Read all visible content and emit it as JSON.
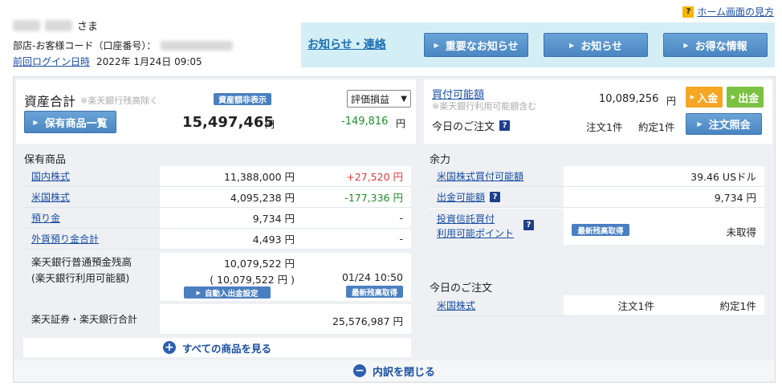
{
  "header": {
    "help_link": "ホーム画面の見方",
    "help_icon": "?",
    "user_suffix": "さま",
    "branch_label": "部店-お客様コード（口座番号）：",
    "last_login_label": "前回ログイン日時",
    "last_login_value": "2022年 1月24日 09:05"
  },
  "notice": {
    "title": "お知らせ・連絡",
    "buttons": [
      "重要なお知らせ",
      "お知らせ",
      "お得な情報"
    ]
  },
  "assets": {
    "label": "資産合計",
    "note": "※楽天銀行残高除く",
    "hide_button": "資産額非表示",
    "holdings_button": "保有商品一覧",
    "total": "15,497,465",
    "yen": "円",
    "select_value": "評価損益",
    "pl": "-149,816",
    "pl_yen": "円"
  },
  "buying": {
    "label": "買付可能額",
    "note": "※楽天銀行利用可能額含む",
    "value": "10,089,256",
    "yen": "円",
    "deposit_button": "入金",
    "withdraw_button": "出金",
    "today_orders_label": "今日のご注文",
    "orders": "注文1件",
    "executed": "約定1件",
    "inquiry_button": "注文照会"
  },
  "holdings": {
    "title": "保有商品",
    "rows": [
      {
        "name": "国内株式",
        "value": "11,388,000 円",
        "pl": "+27,520 円"
      },
      {
        "name": "米国株式",
        "value": "4,095,238 円",
        "pl": "-177,336 円"
      },
      {
        "name": "預り金",
        "value": "9,734 円",
        "pl": "-"
      },
      {
        "name": "外貨預り金合計",
        "value": "4,493 円",
        "pl": "-"
      }
    ],
    "bank_label_1": "楽天銀行普通預金残高",
    "bank_label_2": "(楽天銀行利用可能額)",
    "bank_value": "10,079,522 円",
    "bank_avail": "( 10,079,522 円 )",
    "auto_button": "自動入出金設定",
    "bank_time": "01/24 10:50",
    "latest_button": "最新残高取得",
    "combined_label": "楽天証券・楽天銀行合計",
    "combined_value": "25,576,987 円",
    "see_all": "すべての商品を見る"
  },
  "margin": {
    "title": "余力",
    "rows": [
      {
        "name": "米国株式買付可能額",
        "value": "39.46 USドル"
      },
      {
        "name": "出金可能額",
        "value": "9,734 円"
      }
    ],
    "invest_label_1": "投資信託買付",
    "invest_label_2": "利用可能ポイント",
    "latest_button": "最新残高取得",
    "invest_value": "未取得"
  },
  "today": {
    "title": "今日のご注文",
    "row_name": "米国株式",
    "orders": "注文1件",
    "executed": "約定1件"
  },
  "footer": {
    "close": "内訳を閉じる"
  },
  "colors": {
    "accent": "#4a86c2",
    "notice_bg": "#d4eef6",
    "deposit": "#f5a623",
    "withdraw": "#7cc242"
  }
}
